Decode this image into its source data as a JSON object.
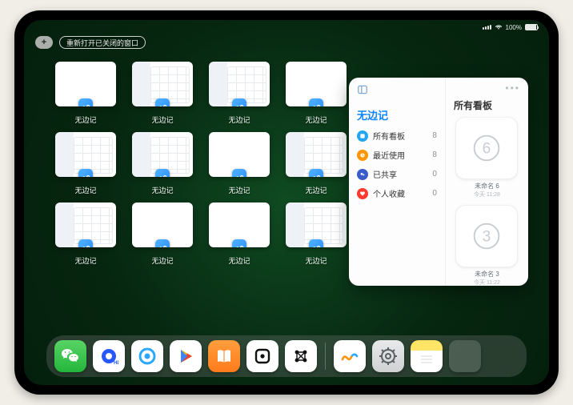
{
  "status": {
    "battery_pct": "100%"
  },
  "topbar": {
    "plus_label": "+",
    "reopen_label": "重新打开已关闭的窗口"
  },
  "app_name": "无边记",
  "thumbnails": [
    {
      "label": "无边记",
      "kind": "blank"
    },
    {
      "label": "无边记",
      "kind": "cal"
    },
    {
      "label": "无边记",
      "kind": "cal"
    },
    {
      "label": "无边记",
      "kind": "blank"
    },
    {
      "label": "无边记",
      "kind": "cal"
    },
    {
      "label": "无边记",
      "kind": "cal"
    },
    {
      "label": "无边记",
      "kind": "blank"
    },
    {
      "label": "无边记",
      "kind": "cal"
    },
    {
      "label": "无边记",
      "kind": "cal"
    },
    {
      "label": "无边记",
      "kind": "blank"
    },
    {
      "label": "无边记",
      "kind": "blank"
    },
    {
      "label": "无边记",
      "kind": "cal"
    }
  ],
  "panel": {
    "title_left": "无边记",
    "title_right": "所有看板",
    "categories": [
      {
        "icon": "blue",
        "label": "所有看板",
        "count": "8"
      },
      {
        "icon": "orange",
        "label": "最近使用",
        "count": "8"
      },
      {
        "icon": "indigo",
        "label": "已共享",
        "count": "0"
      },
      {
        "icon": "red",
        "label": "个人收藏",
        "count": "0"
      }
    ],
    "boards": [
      {
        "glyph": "6",
        "name": "未命名 6",
        "time": "今天 11:28"
      },
      {
        "glyph": "3",
        "name": "未命名 3",
        "time": "今天 11:22"
      }
    ]
  },
  "dock": {
    "apps": [
      {
        "name": "wechat-icon"
      },
      {
        "name": "quark-a-icon"
      },
      {
        "name": "quark-b-icon"
      },
      {
        "name": "play-icon"
      },
      {
        "name": "books-icon"
      },
      {
        "name": "card-icon"
      },
      {
        "name": "connect-icon"
      }
    ],
    "recent": [
      {
        "name": "freeform-app-icon"
      },
      {
        "name": "settings-icon"
      },
      {
        "name": "notes-icon"
      },
      {
        "name": "app-library-icon"
      }
    ]
  }
}
